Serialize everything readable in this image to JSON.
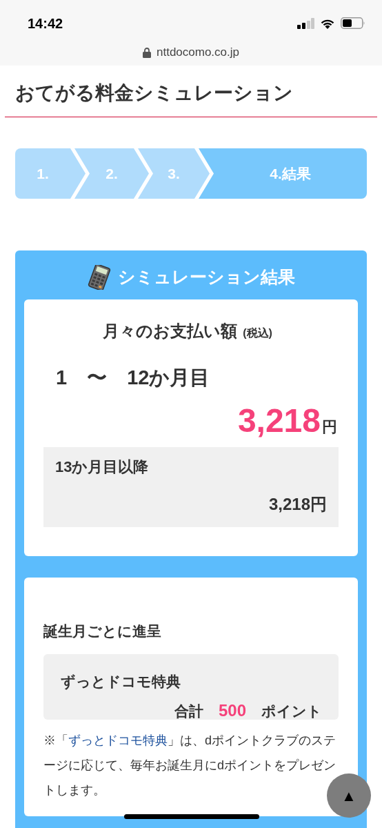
{
  "status_bar": {
    "time": "14:42"
  },
  "address_bar": {
    "domain": "nttdocomo.co.jp"
  },
  "page_title": "おてがる料金シミュレーション",
  "steps": [
    {
      "label": "1.",
      "selected": false
    },
    {
      "label": "2.",
      "selected": false
    },
    {
      "label": "3.",
      "selected": false
    },
    {
      "label": "4.結果",
      "selected": true
    }
  ],
  "result": {
    "title": "シミュレーション結果",
    "monthly": {
      "heading": "月々のお支払い額",
      "tax_note": "(税込)",
      "period": "1　〜　12か月目",
      "amount": "3,218",
      "unit": "円",
      "later_label": "13か月目以降",
      "later_amount": "3,218円"
    },
    "benefit": {
      "heading": "誕生月ごとに進呈",
      "name": "ずっとドコモ特典",
      "total_label": "合計",
      "points": "500",
      "points_unit": "ポイント",
      "note_prefix": "※「",
      "note_link": "ずっとドコモ特典",
      "note_suffix": "」は、dポイントクラブのステージに応じて、毎年お誕生月にdポイントをプレゼントします。"
    }
  },
  "back_to_top": "▲"
}
